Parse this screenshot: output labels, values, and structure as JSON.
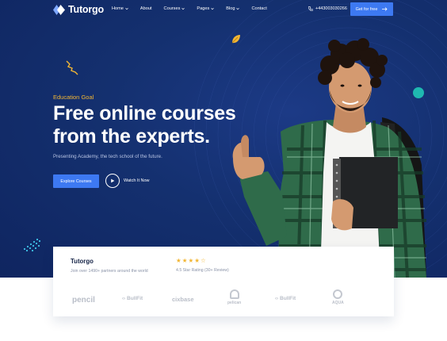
{
  "nav": {
    "logo_text": "Tutorgo",
    "menu": [
      {
        "label": "Home",
        "has_caret": true
      },
      {
        "label": "About",
        "has_caret": false
      },
      {
        "label": "Courses",
        "has_caret": true
      },
      {
        "label": "Pages",
        "has_caret": true
      },
      {
        "label": "Blog",
        "has_caret": true
      },
      {
        "label": "Contact",
        "has_caret": false
      }
    ],
    "phone": "+443003030266",
    "cta_label": "Get for free"
  },
  "hero": {
    "eyebrow": "Education Goal",
    "headline_line1": "Free online courses",
    "headline_line2": "from the experts.",
    "subtext": "Presenting Academy, the tech school of the future.",
    "primary_button": "Explore Courses",
    "watch_label": "Watch It Now"
  },
  "card": {
    "brand_name": "Tutorgo",
    "brand_sub": "Join over 1490+ partners around the world",
    "rating_stars": 4,
    "rating_max": 5,
    "rating_text": "4.5 Star Rating (30+ Review)",
    "partners": [
      "pencil",
      "BullFit",
      "cixbase",
      "pelican",
      "BullFit",
      "AQUA"
    ]
  },
  "colors": {
    "hero_bg": "#14306f",
    "accent_blue": "#3d79f2",
    "eyebrow_gold": "#f2b634",
    "star_gold": "#f2b634",
    "teal_dot": "#1fb8b0"
  },
  "icons": {
    "phone": "phone-icon",
    "arrow": "arrow-right-icon",
    "play": "play-icon",
    "logo": "logo-diamond-icon"
  }
}
